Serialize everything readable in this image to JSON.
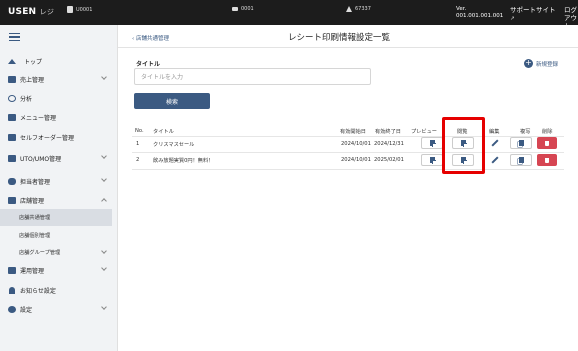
{
  "topbar": {
    "logo": "USEN",
    "logo_sub": "レジ",
    "store_id": "U0001",
    "terminal": "0001",
    "user": "67337",
    "version_label": "Ver.",
    "version_value": "001.001.001.001",
    "support": "サポートサイト",
    "logout_line1": "ログアウ",
    "logout_line2": "ト"
  },
  "sidebar": {
    "items": [
      {
        "label": "トップ"
      },
      {
        "label": "売上管理"
      },
      {
        "label": "分析"
      },
      {
        "label": "メニュー管理"
      },
      {
        "label": "セルフオーダー管理"
      },
      {
        "label": "UTO/UMO管理"
      },
      {
        "label": "担当者管理"
      },
      {
        "label": "店舗管理"
      }
    ],
    "subitems": [
      {
        "label": "店舗共通管理"
      },
      {
        "label": "店舗個別管理"
      },
      {
        "label": "店舗グループ管理"
      }
    ],
    "items_after": [
      {
        "label": "運用管理"
      },
      {
        "label": "お知らせ設定"
      },
      {
        "label": "設定"
      }
    ]
  },
  "main": {
    "breadcrumb": "‹ 店舗共通管理",
    "title": "レシート印刷情報設定一覧",
    "new_label": "新規登録",
    "field_label": "タイトル",
    "field_placeholder": "タイトルを入力",
    "search_label": "検索",
    "columns": [
      "No.",
      "タイトル",
      "有効開始日",
      "有効終了日",
      "プレビュー",
      "閲覧",
      "編集",
      "複写",
      "削除"
    ],
    "rows": [
      {
        "no": "1",
        "title": "クリスマスセール",
        "start": "2024/10/01",
        "end": "2024/12/31"
      },
      {
        "no": "2",
        "title": "飲み放題実質0円！無料！",
        "start": "2024/10/01",
        "end": "2025/02/01"
      }
    ]
  },
  "colors": {
    "accent": "#3b5a82",
    "danger": "#d64552",
    "highlight": "#e60000"
  }
}
